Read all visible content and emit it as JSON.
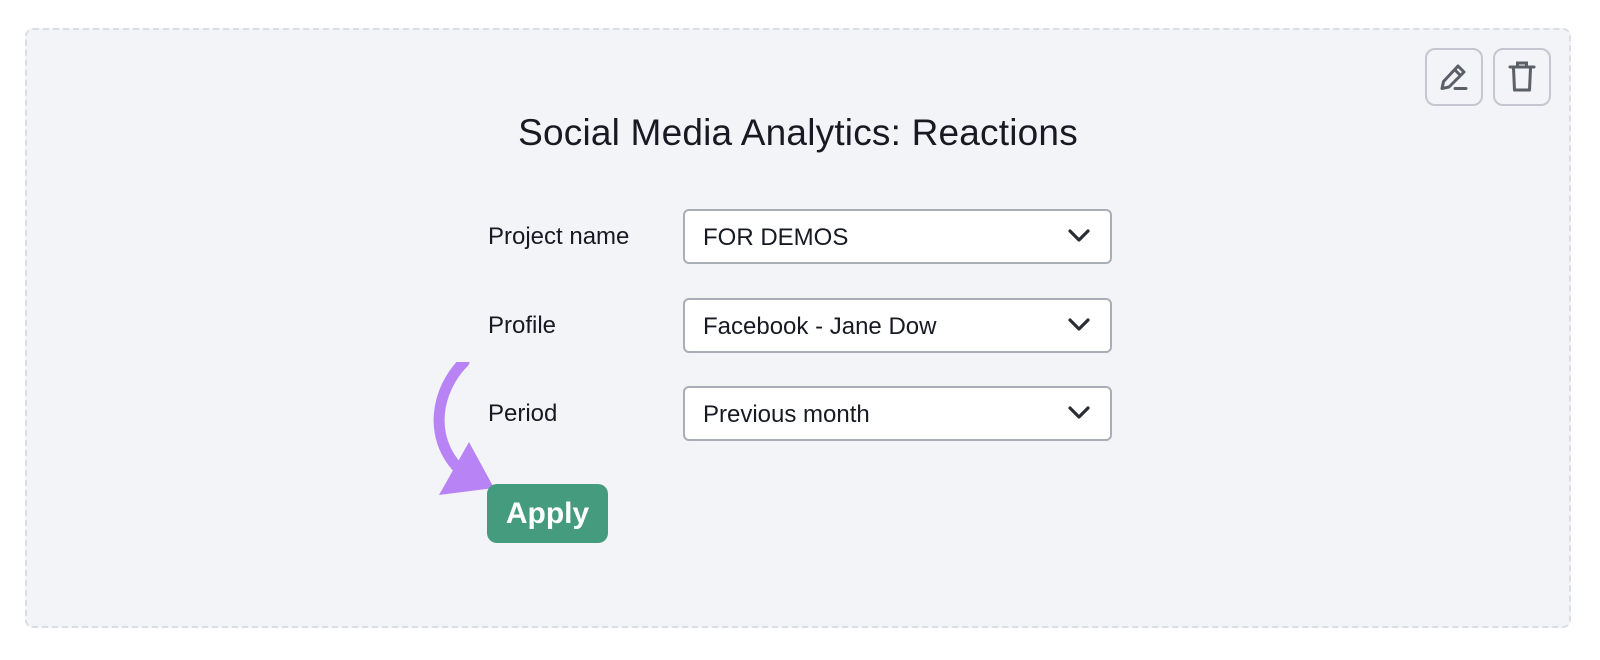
{
  "widget": {
    "title": "Social Media Analytics: Reactions",
    "actions": {
      "edit_icon": "pencil-icon",
      "delete_icon": "trash-icon"
    }
  },
  "form": {
    "fields": [
      {
        "label": "Project name",
        "value": "FOR DEMOS"
      },
      {
        "label": "Profile",
        "value": "Facebook - Jane Dow"
      },
      {
        "label": "Period",
        "value": "Previous month"
      }
    ],
    "apply_label": "Apply"
  },
  "colors": {
    "widget_background": "#f3f4f8",
    "apply_button": "#459b7d",
    "annotation_arrow": "#b884f5",
    "text": "#171a22"
  }
}
